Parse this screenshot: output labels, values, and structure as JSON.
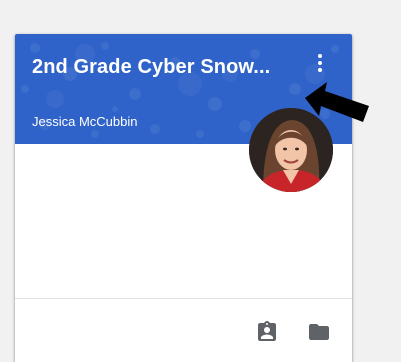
{
  "card": {
    "title": "2nd Grade Cyber Snow...",
    "teacher": "Jessica McCubbin",
    "banner_color": "#2f63c9"
  },
  "icons": {
    "menu": "more-vert-icon",
    "assignments": "assignment-ind-icon",
    "folder": "folder-icon",
    "pointer": "black-arrow-annotation"
  }
}
